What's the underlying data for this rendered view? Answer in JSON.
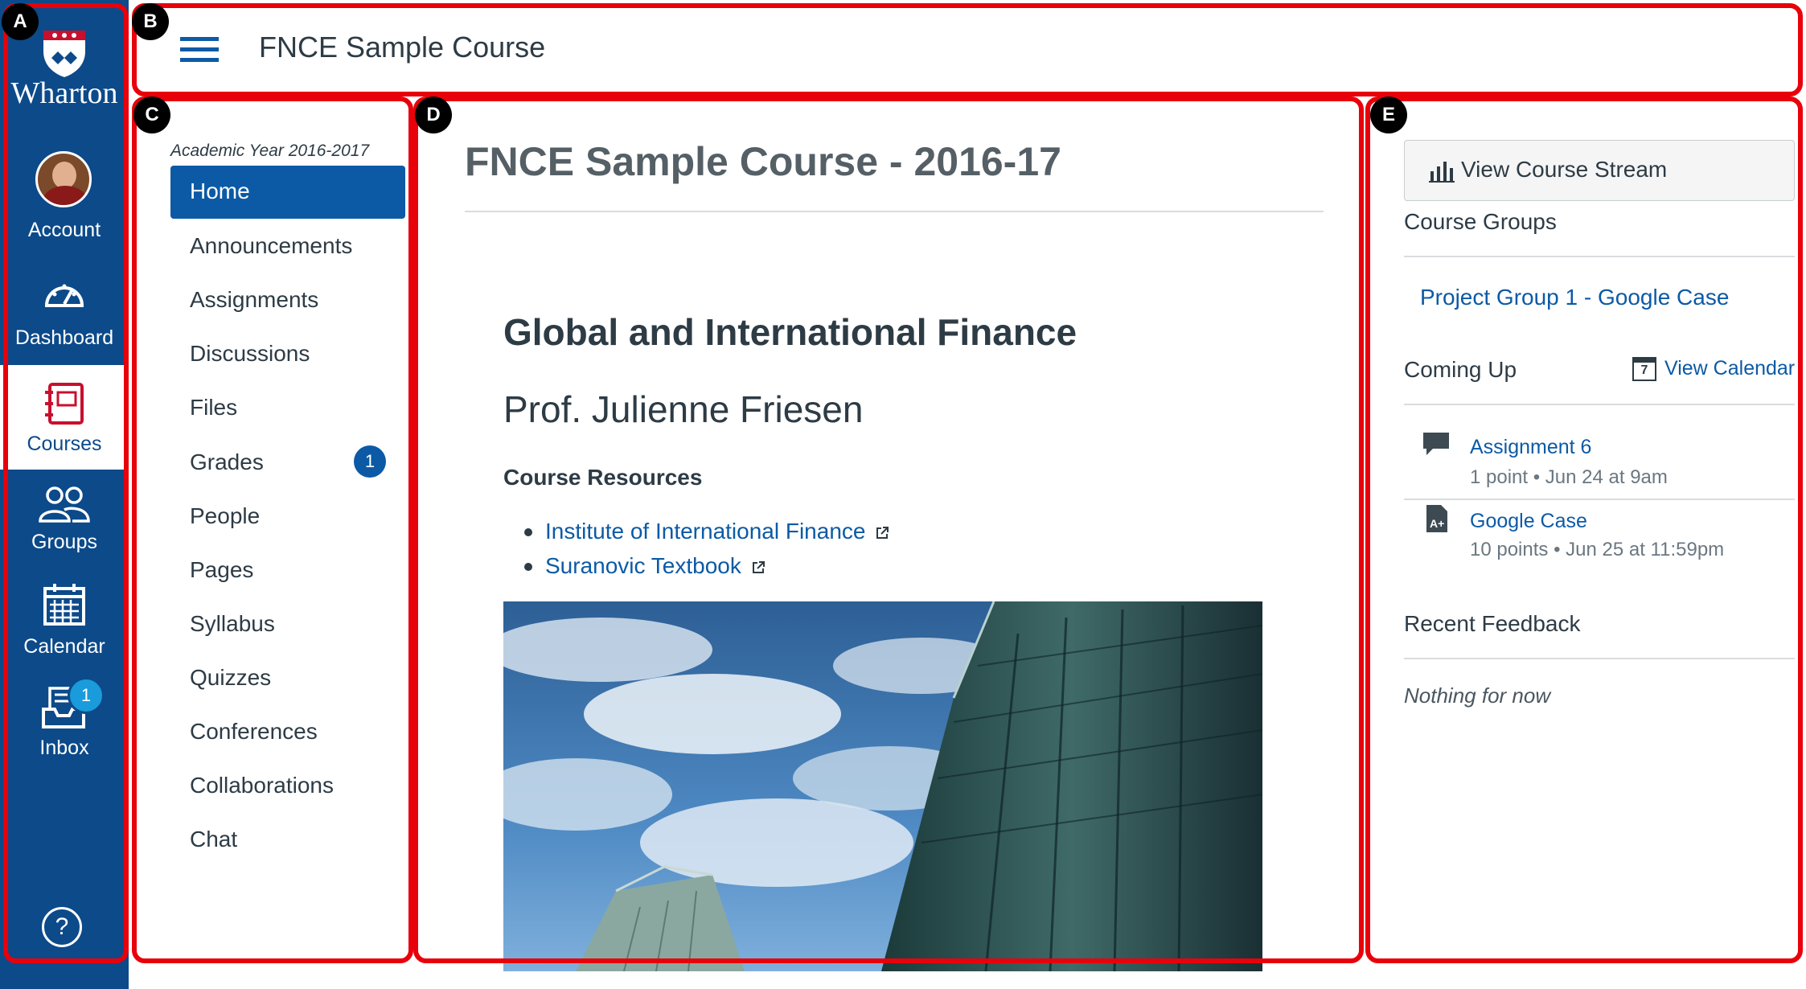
{
  "global_nav": {
    "logo_text": "Wharton",
    "items": [
      {
        "label": "Account",
        "icon": "avatar"
      },
      {
        "label": "Dashboard",
        "icon": "speedometer-icon"
      },
      {
        "label": "Courses",
        "icon": "notebook-icon"
      },
      {
        "label": "Groups",
        "icon": "people-icon"
      },
      {
        "label": "Calendar",
        "icon": "calendar-icon"
      },
      {
        "label": "Inbox",
        "icon": "inbox-icon",
        "badge": "1"
      }
    ],
    "help_label": "?"
  },
  "header": {
    "course_title": "FNCE Sample Course"
  },
  "course_nav": {
    "academic_year": "Academic Year 2016-2017",
    "items": [
      {
        "label": "Home"
      },
      {
        "label": "Announcements"
      },
      {
        "label": "Assignments"
      },
      {
        "label": "Discussions"
      },
      {
        "label": "Files"
      },
      {
        "label": "Grades",
        "badge": "1"
      },
      {
        "label": "People"
      },
      {
        "label": "Pages"
      },
      {
        "label": "Syllabus"
      },
      {
        "label": "Quizzes"
      },
      {
        "label": "Conferences"
      },
      {
        "label": "Collaborations"
      },
      {
        "label": "Chat"
      }
    ]
  },
  "main": {
    "page_heading": "FNCE Sample Course - 2016-17",
    "content_title": "Global and International Finance",
    "professor": "Prof. Julienne Friesen",
    "resources_heading": "Course Resources",
    "resources": [
      {
        "label": "Institute of International Finance"
      },
      {
        "label": "Suranovic Textbook"
      }
    ]
  },
  "sidebar": {
    "stream_button": "View Course Stream",
    "course_groups_heading": "Course Groups",
    "group_link": "Project Group 1 - Google Case",
    "coming_up_heading": "Coming Up",
    "view_calendar": "View Calendar",
    "calendar_day": "7",
    "upcoming": [
      {
        "title": "Assignment 6",
        "meta": "1 point • Jun 24 at 9am",
        "icon": "discussion-icon"
      },
      {
        "title": "Google Case",
        "meta": "10 points • Jun 25 at 11:59pm",
        "icon": "assignment-icon"
      }
    ],
    "recent_feedback_heading": "Recent Feedback",
    "recent_feedback_empty": "Nothing for now"
  },
  "callouts": [
    "A",
    "B",
    "C",
    "D",
    "E"
  ],
  "colors": {
    "nav_blue": "#0c4a8a",
    "link_blue": "#0c5aa6",
    "callout_red": "#e8000b"
  }
}
